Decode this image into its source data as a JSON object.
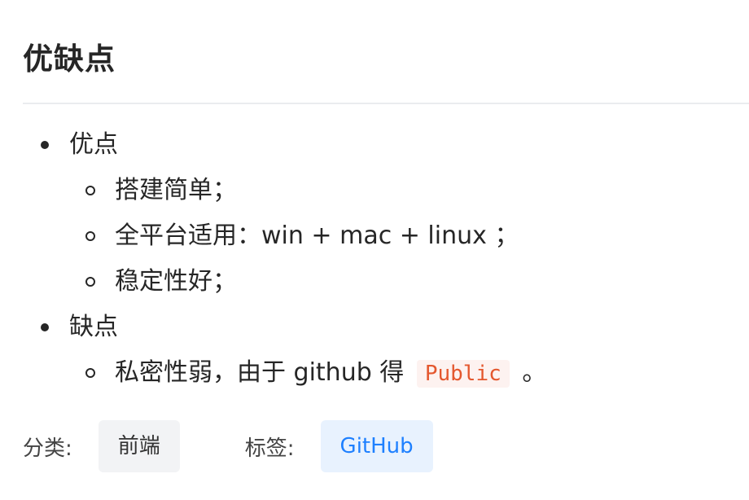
{
  "section": {
    "title": "优缺点"
  },
  "pros": {
    "label": "优点",
    "items": [
      "搭建简单；",
      "全平台适用：win + mac + linux ；",
      "稳定性好；"
    ]
  },
  "cons": {
    "label": "缺点",
    "item_prefix": "私密性弱，由于 github 得",
    "item_code": "Public",
    "item_suffix": "。"
  },
  "meta": {
    "category_label": "分类:",
    "category_value": "前端",
    "tag_label": "标签:",
    "tag_value": "GitHub"
  }
}
